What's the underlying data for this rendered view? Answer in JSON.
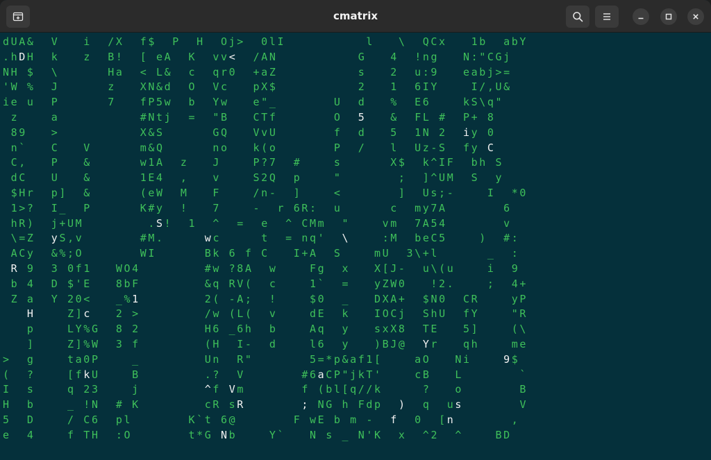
{
  "window": {
    "title": "cmatrix",
    "buttons": {
      "new_tab": "new-tab-icon",
      "search": "search-icon",
      "menu": "hamburger-menu-icon",
      "minimize": "minimize-icon",
      "maximize": "maximize-icon",
      "close": "close-icon"
    }
  },
  "colors": {
    "terminal_background": "#05303b",
    "matrix_green": "#3fc05a",
    "highlight_white": "#f2f2f2",
    "titlebar": "#2b2b2b"
  },
  "terminal": {
    "lines": [
      "dUA&  V   i  /X  f$  P  H  Oj>  0lI          l   \\  QCx   1b  abY",
      ".hDH  k   z  B!  [ eA  K  vv<  /AN          G   4  !ng   N:\"CGj",
      "NH $  \\      Ha  < L&  c  qr0  +aZ          s   2  u:9   eabj>=",
      "'W %  J      z   XN&d  O  Vc   pX$          2   1  6IY    I/,U&",
      "ie u  P      7   fP5w  b  Yw   e\"_       U  d   %  E6    kS\\q\"",
      " z    a          #Ntj  =  \"B   CTf       O  5   &  FL #  P+ 8",
      " 89   >          X&S      GQ   VvU       f  d   5  1N 2  iy 0",
      " n`   C   V      m&Q      no   k(o       P  /   l  Uz-S  fy C",
      " C,   P   &      w1A  z   J    P?7  #    s      X$  k^IF  bh S",
      " dC   U   &      1E4  ,   v    S2Q  p    \"       ;  ]^UM  S  y",
      " $Hr  p]  &      (eW  M   F    /n-  ]    <       ]  Us;-    I  *0",
      " 1>?  I_  P      K#y  !   7    -  r 6R:  u      c  my7A       6",
      " hR)  j+UM        .S!  1  ^  =  e  ^ CMm  \"    vm  7A54       v",
      " \\=Z  yS,v       #M.     wc     t  = nq'  \\    :M  beC5    )  #:",
      " ACy  &%;O       WI      Bk 6 f C   I+A  S    mU  3\\+l      _  :",
      " R 9  3 0f1   WO4        #w ?8A  w    Fg  x   X[J-  u\\(u    i  9",
      " b 4  D $'E   8bF        &q RV(  c    1`  =   yZW0   !2.    ;  4+",
      " Z a  Y 20<   _%1        2( -A;  !    $0  _   DXA+  $N0  CR    yP",
      "   H    Z]c   2 >        /w (L(  v    dE  k   IOCj  ShU  fY    \"R",
      "   p    LY%G  8 2        H6 _6h  b    Aq  y   sxX8  TE   5]    (\\",
      "   ]    Z]%W  3 f        (H  I-  d    l6  y   )BJ@  Yr   qh    me",
      ">  g    ta0P    _        Un  R\"       5=*p&af1[    aO   Ni    9$",
      "(  ?    [fkU    B        .?  V       #6aCP\"jkT'    cB   L       `",
      "I  s    q 23    j        ^f Vm       f (bl[q//k     ?   o       B",
      "H  b    _ !N  # K        cR sR       ; NG h Fdp  )  q  us       V",
      "5  D    / C6  pl       K`t 6@       F wE b m -  f  0  [n       ,",
      "e  4    f TH  :O       t*G Nb    Y`   N s _ N'K  x  ^2  ^    BD"
    ],
    "white_cells": [
      "1:2",
      "2:24",
      "1:28",
      "3:42",
      "3:24",
      "9:15",
      "14:35",
      "34:28",
      "5:44",
      "6:57",
      "7:60",
      "8:63",
      "9:69",
      "10:59",
      "11:27",
      "12:49",
      "12:19",
      "13:42",
      "13:25",
      "13:6",
      "14:21",
      "15:1",
      "15:4",
      "15:41",
      "15:50",
      "15:56",
      "16:62",
      "16:68",
      "17:16",
      "18:66",
      "18:10",
      "18:76",
      "18:3",
      "20:52",
      "20:68",
      "21:75",
      "21:62",
      "22:55",
      "22:18",
      "22:10",
      "22:12",
      "24:37",
      "24:15",
      "24:70",
      "27:30",
      "22:39",
      "23:25",
      "23:28",
      "24:29",
      "24:49",
      "24:56",
      "24:59",
      "25:30",
      "25:48",
      "25:55",
      "26:27"
    ]
  }
}
